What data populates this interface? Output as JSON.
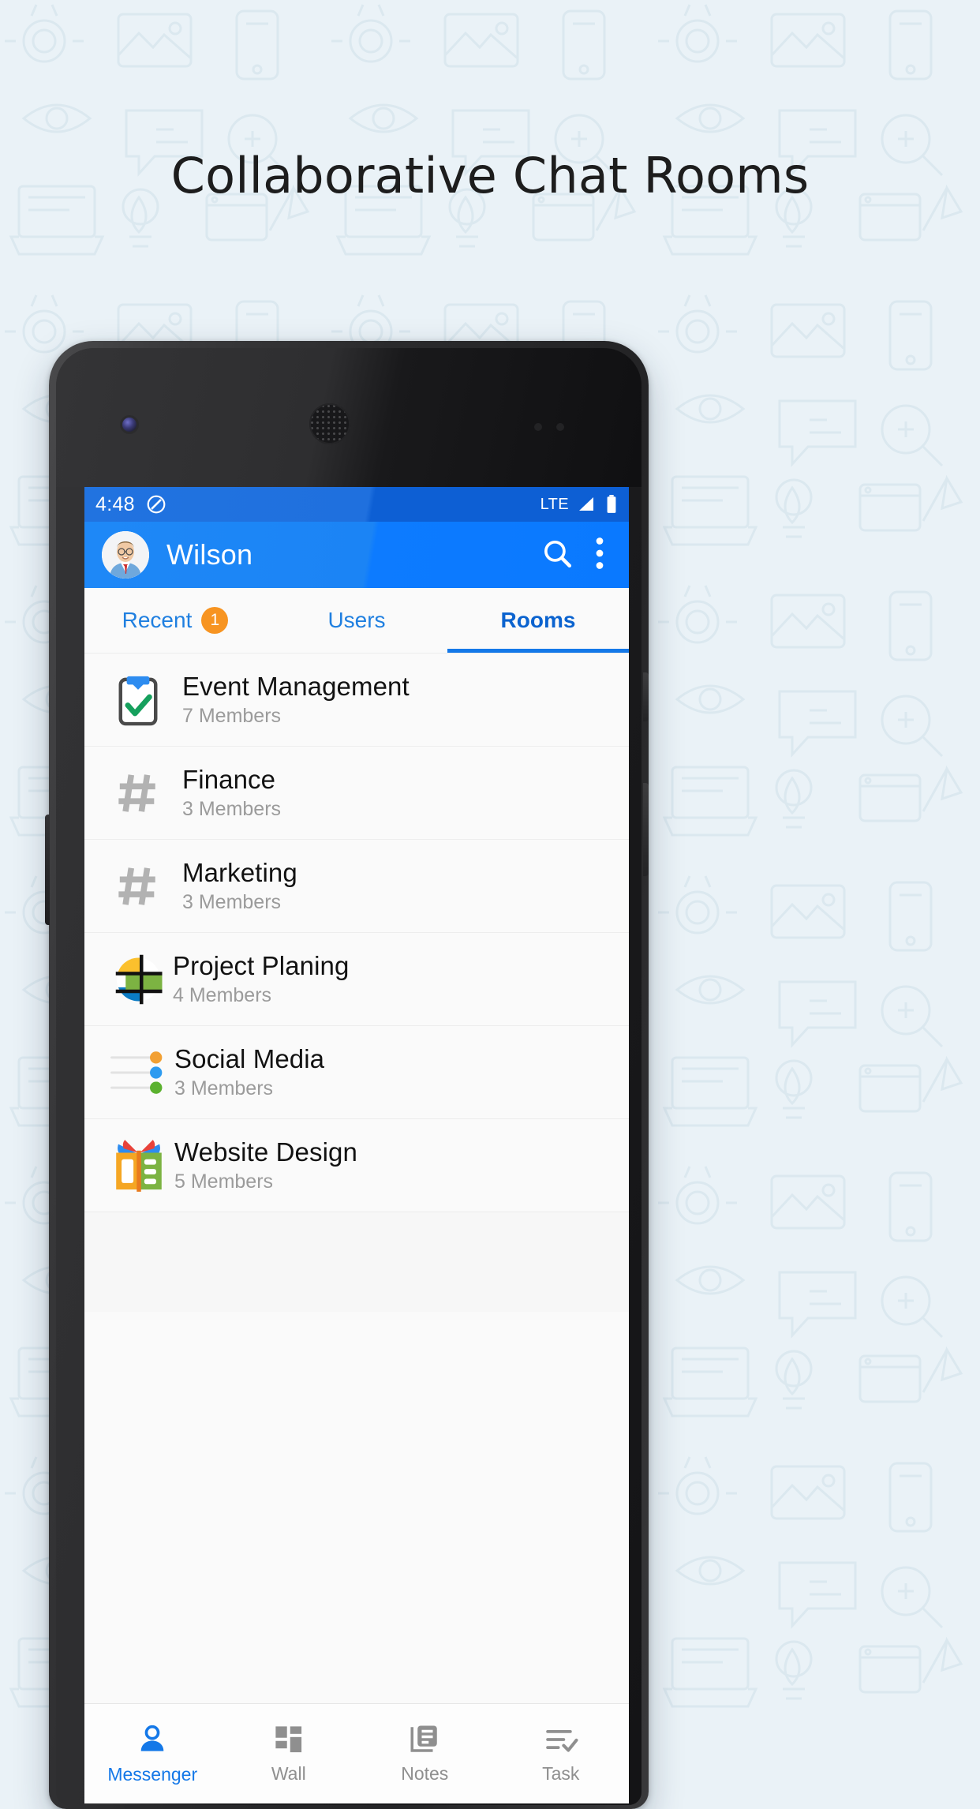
{
  "page": {
    "headline": "Collaborative Chat Rooms",
    "bg_color": "#eaf2f7",
    "accent_color": "#1478e8"
  },
  "status_bar": {
    "time": "4:48",
    "dnd_icon": "do-not-disturb-icon",
    "network": "LTE",
    "signal_icon": "signal-bars-icon",
    "battery_icon": "battery-full-icon"
  },
  "app_bar": {
    "avatar": "user-avatar",
    "title": "Wilson",
    "search_icon": "search-icon",
    "overflow_icon": "overflow-menu-icon",
    "color": "#0d7bff"
  },
  "tabs": [
    {
      "label": "Recent",
      "badge": "1",
      "active": false
    },
    {
      "label": "Users",
      "badge": "",
      "active": false
    },
    {
      "label": "Rooms",
      "badge": "",
      "active": true
    }
  ],
  "rooms": [
    {
      "name": "Event Management",
      "members": "7 Members",
      "icon": "clipboard-check-icon"
    },
    {
      "name": "Finance",
      "members": "3 Members",
      "icon": "hash-icon"
    },
    {
      "name": "Marketing",
      "members": "3 Members",
      "icon": "hash-icon"
    },
    {
      "name": "Project Planing",
      "members": "4 Members",
      "icon": "pie-chart-icon"
    },
    {
      "name": "Social Media",
      "members": "3 Members",
      "icon": "feed-dots-icon"
    },
    {
      "name": "Website Design",
      "members": "5 Members",
      "icon": "open-book-icon"
    }
  ],
  "bottom_nav": [
    {
      "label": "Messenger",
      "icon": "person-icon",
      "active": true
    },
    {
      "label": "Wall",
      "icon": "grid-tiles-icon",
      "active": false
    },
    {
      "label": "Notes",
      "icon": "documents-icon",
      "active": false
    },
    {
      "label": "Task",
      "icon": "checklist-icon",
      "active": false
    }
  ],
  "colors": {
    "badge_orange": "#f79421",
    "tab_blue": "#1f7fe0",
    "muted_text": "#9b9b9b"
  }
}
